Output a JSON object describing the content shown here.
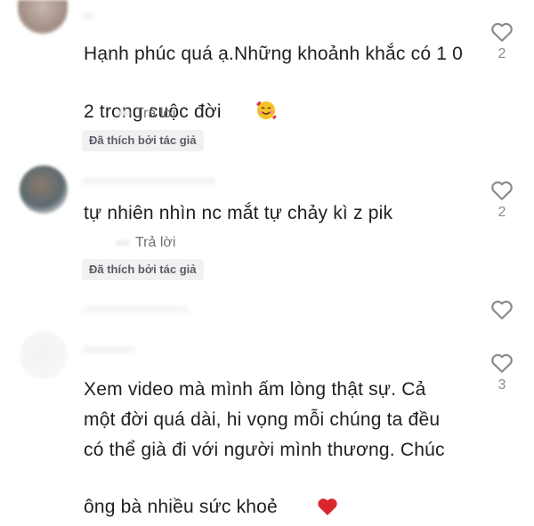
{
  "comments": [
    {
      "text": "Hạnh phúc quá ạ.Những khoảnh khắc có 1 0 2 trong cuộc đời",
      "reply_label": "Trả lời",
      "badge": "Đã thích bởi tác giả",
      "like_count": "2",
      "emoji_icon": "smiling-face-with-hearts-icon"
    },
    {
      "text": "tự nhiên nhìn nc mắt tự chảy kì z pik",
      "reply_label": "Trả lời",
      "badge": "Đã thích bởi tác giả",
      "like_count": "2"
    },
    {
      "text": "",
      "like_count": ""
    },
    {
      "text": "Xem video mà mình ấm lòng thật sự. Cả một đời quá dài, hi vọng mỗi chúng ta đều có thể già đi với người mình thương. Chúc ông bà nhiều sức khoẻ",
      "like_count": "3",
      "emoji_icon": "red-heart-icon"
    }
  ],
  "colors": {
    "heart_outline": "#8a8b91",
    "badge_bg": "#f1f1f2",
    "red_heart": "#d9262e"
  }
}
